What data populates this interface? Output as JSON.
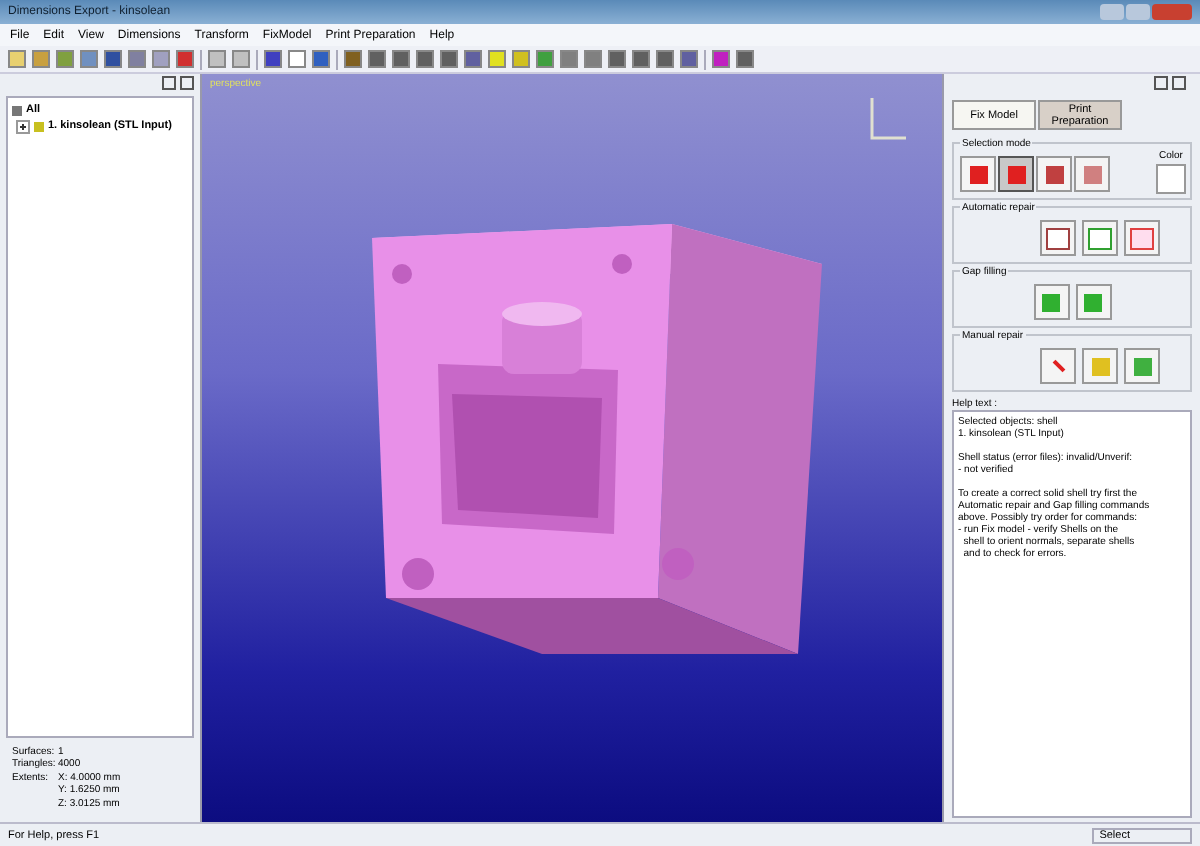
{
  "window": {
    "title": "Dimensions Export - kinsolean"
  },
  "menu": [
    "File",
    "Edit",
    "View",
    "Dimensions",
    "Transform",
    "FixModel",
    "Print Preparation",
    "Help"
  ],
  "tree": {
    "root": "All",
    "children": [
      {
        "label": "1. kinsolean (STL Input)"
      }
    ]
  },
  "stats": [
    {
      "label": "Surfaces:",
      "value": "1"
    },
    {
      "label": "Triangles:",
      "value": "4000"
    },
    {
      "label": "Extents:",
      "value": "X: 4.0000 mm"
    },
    {
      "value": "Y: 1.6250 mm"
    },
    {
      "value": "Z: 3.0125 mm"
    }
  ],
  "viewport": {
    "label": "perspective"
  },
  "tabs": [
    {
      "label": "Fix Model",
      "selected": true
    },
    {
      "label": "Print Preparation",
      "selected": false
    }
  ],
  "selection_mode": {
    "title": "Selection mode",
    "buttons": [
      {
        "selected": false
      },
      {
        "selected": true
      },
      {
        "selected": false
      },
      {
        "selected": false
      }
    ],
    "color_label": "Color"
  },
  "automatic_repair": {
    "title": "Automatic repair"
  },
  "gap_filling": {
    "title": "Gap filling"
  },
  "manual_repair": {
    "title": "Manual repair"
  },
  "help": {
    "label": "Help text :",
    "paragraphs": [
      [
        "Selected objects: shell",
        "1. kinsolean (STL Input)"
      ],
      [
        "Shell status (error files): invalid/Unverif:",
        "- not verified"
      ],
      [
        "To create a correct solid shell try first the",
        "Automatic repair and Gap filling commands",
        "above. Possibly try order for commands:",
        "- run Fix model - verify Shells on the",
        "  shell to orient normals, separate shells",
        "  and to check for errors."
      ]
    ]
  },
  "status_bar": {
    "hint": "For Help, press F1",
    "mode": "Select"
  }
}
